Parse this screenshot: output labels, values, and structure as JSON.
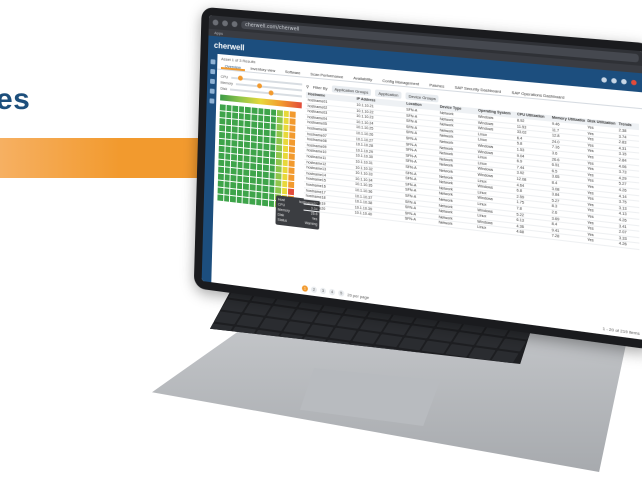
{
  "background": {
    "heading_fragment": "es",
    "accent_color": "#f29a2e",
    "brand_color": "#1d4f7c"
  },
  "browser": {
    "url": "cherwell.com/cherwell",
    "bookmark_label": "Apps"
  },
  "app": {
    "logo": "cherwell",
    "breadcrumb": "Asset 1 of 3 Results",
    "tabs": [
      "Overview",
      "Inventory view",
      "Software",
      "Scan Performance",
      "Availability",
      "Config Management",
      "Patches",
      "SAP Security Dashboard",
      "SAP Operations Dashboard"
    ],
    "toolbar": {
      "filter_label": "Filter By",
      "chips": [
        "Application Groups",
        "Application",
        "Device Groups"
      ]
    },
    "table": {
      "headers": [
        "Hostname",
        "IP Address",
        "Location",
        "Device Type",
        "Operating System",
        "CPU Utilization",
        "Memory Utilization",
        "Disk Utilization",
        "Trends"
      ],
      "rows": [
        [
          "hostname01",
          "10.1.10.21",
          "SFN-A",
          "Network",
          "Windows",
          "8.92",
          "9.46",
          "Yes",
          "2.38"
        ],
        [
          "hostname02",
          "10.1.10.22",
          "SFN-A",
          "Network",
          "Windows",
          "11.53",
          "11.7",
          "Yes",
          "3.74"
        ],
        [
          "hostname03",
          "10.1.10.23",
          "SFN-A",
          "Network",
          "Windows",
          "33.02",
          "12.8",
          "Yes",
          "2.83"
        ],
        [
          "hostname04",
          "10.1.10.24",
          "SFN-A",
          "Network",
          "Linux",
          "6.4",
          "24.0",
          "Yes",
          "4.31"
        ],
        [
          "hostname05",
          "10.1.10.25",
          "SFN-A",
          "Network",
          "Linux",
          "5.8",
          "7.16",
          "Yes",
          "3.15"
        ],
        [
          "hostname06",
          "10.1.10.26",
          "SFN-A",
          "Network",
          "Windows",
          "1.53",
          "3.6",
          "Yes",
          "2.84"
        ],
        [
          "hostname07",
          "10.1.10.27",
          "SFN-A",
          "Network",
          "Windows",
          "9.04",
          "26.6",
          "Yes",
          "4.06"
        ],
        [
          "hostname08",
          "10.1.10.28",
          "SFN-A",
          "Network",
          "Linux",
          "6.9",
          "6.51",
          "Yes",
          "3.73"
        ],
        [
          "hostname09",
          "10.1.10.29",
          "SFN-A",
          "Network",
          "Linux",
          "7.44",
          "6.5",
          "Yes",
          "4.29"
        ],
        [
          "hostname10",
          "10.1.10.30",
          "SFN-A",
          "Network",
          "Windows",
          "3.92",
          "3.65",
          "Yes",
          "5.27"
        ],
        [
          "hostname11",
          "10.1.10.31",
          "SFN-A",
          "Network",
          "Windows",
          "12.08",
          "8.4",
          "Yes",
          "4.26"
        ],
        [
          "hostname12",
          "10.1.10.32",
          "SFN-A",
          "Network",
          "Linux",
          "4.64",
          "3.08",
          "Yes",
          "4.14"
        ],
        [
          "hostname13",
          "10.1.10.33",
          "SFN-A",
          "Network",
          "Windows",
          "6.8",
          "3.84",
          "Yes",
          "3.75"
        ],
        [
          "hostname14",
          "10.1.10.34",
          "SFN-A",
          "Network",
          "Linux",
          "2.59",
          "5.27",
          "Yes",
          "3.13"
        ],
        [
          "hostname15",
          "10.1.10.35",
          "SFN-A",
          "Network",
          "Windows",
          "1.75",
          "8.3",
          "Yes",
          "4.13"
        ],
        [
          "hostname16",
          "10.1.10.36",
          "SFN-A",
          "Network",
          "Linux",
          "7.8",
          "2.6",
          "Yes",
          "4.26"
        ],
        [
          "hostname17",
          "10.1.10.37",
          "SFN-A",
          "Network",
          "Windows",
          "5.22",
          "3.69",
          "Yes",
          "3.41"
        ],
        [
          "hostname18",
          "10.1.10.38",
          "SFN-A",
          "Network",
          "Linux",
          "6.13",
          "8.4",
          "Yes",
          "2.07"
        ],
        [
          "hostname19",
          "10.1.10.39",
          "SFN-A",
          "Network",
          "Windows",
          "4.36",
          "9.41",
          "Yes",
          "3.33"
        ],
        [
          "hostname20",
          "10.1.10.40",
          "SFN-A",
          "Network",
          "Linux",
          "4.68",
          "7.28",
          "Yes",
          "4.26"
        ]
      ]
    },
    "tooltip_rows": [
      [
        "Host",
        "hostname07"
      ],
      [
        "CPU",
        "9.04"
      ],
      [
        "Memory",
        "26.6"
      ],
      [
        "Disk",
        "Yes"
      ],
      [
        "Status",
        "Warning"
      ]
    ],
    "pager": {
      "pages": [
        "1",
        "2",
        "3",
        "4",
        "5"
      ],
      "active_page": "1",
      "per_page": "20 per page",
      "count": "1 - 20 of 219 items"
    },
    "left_panel": {
      "filters": [
        "CPU",
        "Memory",
        "Disk"
      ],
      "legend_label": "Utilization"
    }
  }
}
